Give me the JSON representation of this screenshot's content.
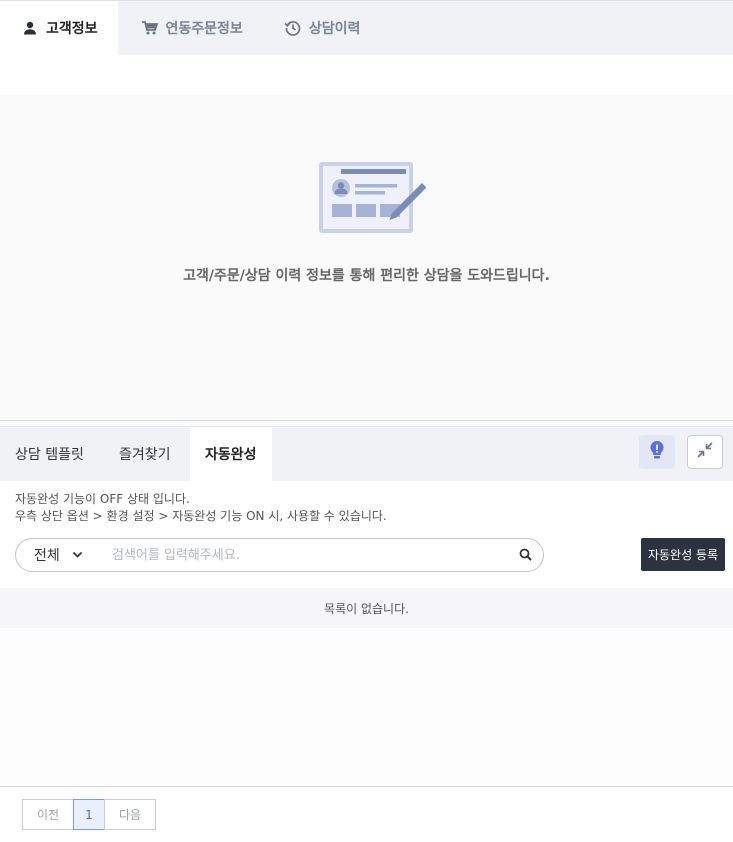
{
  "top_tabs": [
    {
      "label": "고객정보",
      "icon": "user-icon",
      "active": true
    },
    {
      "label": "연동주문정보",
      "icon": "cart-icon",
      "active": false
    },
    {
      "label": "상담이력",
      "icon": "history-icon",
      "active": false
    }
  ],
  "info_panel": {
    "message": "고객/주문/상담 이력 정보를 통해 편리한 상담을 도와드립니다."
  },
  "bottom_tabs": [
    {
      "label": "상담 템플릿",
      "active": false
    },
    {
      "label": "즐겨찾기",
      "active": false
    },
    {
      "label": "자동완성",
      "active": true
    }
  ],
  "toolbar": {
    "bulb_icon": "lightbulb-icon",
    "collapse_icon": "collapse-icon"
  },
  "notice": {
    "line1": "자동완성 기능이 OFF 상태 입니다.",
    "line2": "우측 상단 옵션 > 환경 설정 > 자동완성 기능 ON 시, 사용할 수 있습니다."
  },
  "search": {
    "filter_value": "전체",
    "placeholder": "검색어를 입력해주세요.",
    "value": ""
  },
  "register_button": "자동완성 등록",
  "list": {
    "empty_message": "목록이 없습니다."
  },
  "pagination": {
    "prev": "이전",
    "current": "1",
    "next": "다음"
  },
  "colors": {
    "accent": "#4a6fd8",
    "dark_button": "#2b3240",
    "tab_bg": "#f1f2f6",
    "illustration": "#a6b3d4"
  }
}
